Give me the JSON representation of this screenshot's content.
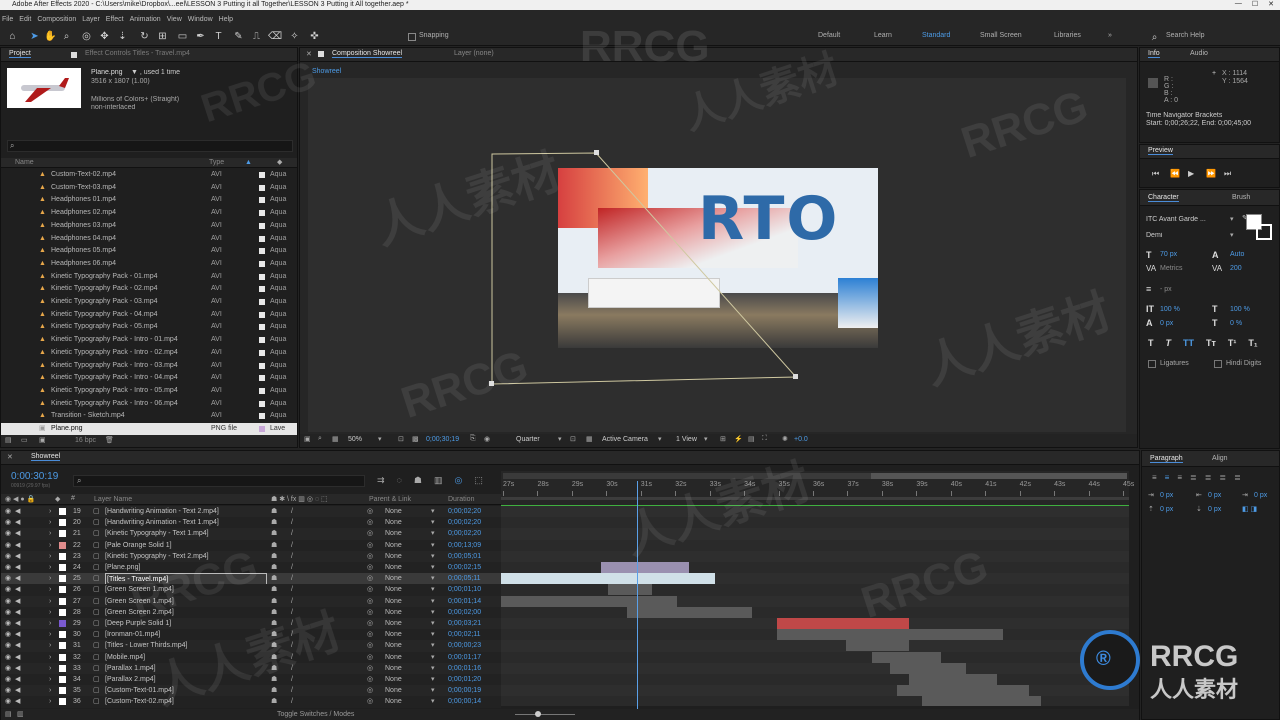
{
  "titlebar": {
    "title": "Adobe After Effects 2020 - C:\\Users\\mike\\Dropbox\\...eel\\LESSON 3 Putting it all Together\\LESSON 3 Putting it All together.aep *"
  },
  "menu": [
    "File",
    "Edit",
    "Composition",
    "Layer",
    "Effect",
    "Animation",
    "View",
    "Window",
    "Help"
  ],
  "toolbar": {
    "snapping": "Snapping",
    "workspaces": [
      "Default",
      "Learn",
      "Standard",
      "Small Screen",
      "Libraries"
    ],
    "active_workspace": "Standard",
    "search_help": "Search Help"
  },
  "project": {
    "tab_project": "Project",
    "tab_effects": "Effect Controls Titles - Travel.mp4",
    "item_name": "Plane.png",
    "item_used": ", used 1 time",
    "item_dims": "3516 x 1807 (1.00)",
    "item_colors": "Millions of Colors+ (Straight)",
    "item_interlace": "non-interlaced",
    "col_name": "Name",
    "col_type": "Type",
    "files": [
      {
        "name": "Custom-Text-02.mp4",
        "type": "AVI",
        "label": "Aqua"
      },
      {
        "name": "Custom-Text-03.mp4",
        "type": "AVI",
        "label": "Aqua"
      },
      {
        "name": "Headphones 01.mp4",
        "type": "AVI",
        "label": "Aqua"
      },
      {
        "name": "Headphones 02.mp4",
        "type": "AVI",
        "label": "Aqua"
      },
      {
        "name": "Headphones 03.mp4",
        "type": "AVI",
        "label": "Aqua"
      },
      {
        "name": "Headphones 04.mp4",
        "type": "AVI",
        "label": "Aqua"
      },
      {
        "name": "Headphones 05.mp4",
        "type": "AVI",
        "label": "Aqua"
      },
      {
        "name": "Headphones 06.mp4",
        "type": "AVI",
        "label": "Aqua"
      },
      {
        "name": "Kinetic Typography Pack - 01.mp4",
        "type": "AVI",
        "label": "Aqua"
      },
      {
        "name": "Kinetic Typography Pack - 02.mp4",
        "type": "AVI",
        "label": "Aqua"
      },
      {
        "name": "Kinetic Typography Pack - 03.mp4",
        "type": "AVI",
        "label": "Aqua"
      },
      {
        "name": "Kinetic Typography Pack - 04.mp4",
        "type": "AVI",
        "label": "Aqua"
      },
      {
        "name": "Kinetic Typography Pack - 05.mp4",
        "type": "AVI",
        "label": "Aqua"
      },
      {
        "name": "Kinetic Typography Pack - Intro - 01.mp4",
        "type": "AVI",
        "label": "Aqua"
      },
      {
        "name": "Kinetic Typography Pack - Intro - 02.mp4",
        "type": "AVI",
        "label": "Aqua"
      },
      {
        "name": "Kinetic Typography Pack - Intro - 03.mp4",
        "type": "AVI",
        "label": "Aqua"
      },
      {
        "name": "Kinetic Typography Pack - Intro - 04.mp4",
        "type": "AVI",
        "label": "Aqua"
      },
      {
        "name": "Kinetic Typography Pack - Intro - 05.mp4",
        "type": "AVI",
        "label": "Aqua"
      },
      {
        "name": "Kinetic Typography Pack - Intro - 06.mp4",
        "type": "AVI",
        "label": "Aqua"
      },
      {
        "name": "Transition - Sketch.mp4",
        "type": "AVI",
        "label": "Aqua"
      },
      {
        "name": "Plane.png",
        "type": "PNG file",
        "label": "Lave"
      }
    ],
    "bpc": "16 bpc"
  },
  "composition": {
    "tab": "Composition Showreel",
    "layer_tab": "Layer (none)",
    "breadcrumb": "Showreel",
    "zoom": "50%",
    "timecode": "0;00;30;19",
    "resolution": "Quarter",
    "camera": "Active Camera",
    "view": "1 View",
    "exposure": "+0.0",
    "preview_text": "RTO"
  },
  "info": {
    "tab_info": "Info",
    "tab_audio": "Audio",
    "rgb": [
      "R :",
      "G :",
      "B :",
      "A : 0"
    ],
    "x": "X : 1114",
    "y": "Y : 1564",
    "nav_title": "Time Navigator Brackets",
    "nav_range": "Start: 0;00;26;22, End: 0;00;45;00",
    "preview": "Preview"
  },
  "character": {
    "tab_character": "Character",
    "tab_brush": "Brush",
    "font": "ITC Avant Garde ...",
    "style": "Demi",
    "size": "70 px",
    "leading": "Auto",
    "kerning": "Metrics",
    "tracking": "200",
    "stroke": "- px",
    "vscale": "100 %",
    "hscale": "100 %",
    "baseline": "0 px",
    "tsume": "0 %",
    "ligatures": "Ligatures",
    "hindi": "Hindi Digits",
    "fill_color": "#ffffff",
    "stroke_color": "#ffffff"
  },
  "paragraph": {
    "tab_paragraph": "Paragraph",
    "tab_align": "Align",
    "indent_values": [
      "0 px",
      "0 px",
      "0 px",
      "0 px",
      "0 px"
    ]
  },
  "timeline": {
    "tab": "Showreel",
    "timecode": "0:00:30:19",
    "fps": "00919 (29.97 fps)",
    "col_layer": "Layer Name",
    "col_parent": "Parent & Link",
    "col_duration": "Duration",
    "ruler": [
      "27s",
      "28s",
      "29s",
      "30s",
      "31s",
      "32s",
      "33s",
      "34s",
      "35s",
      "36s",
      "37s",
      "38s",
      "39s",
      "40s",
      "41s",
      "42s",
      "43s",
      "44s",
      "45s"
    ],
    "toggle_label": "Toggle Switches / Modes",
    "layers": [
      {
        "num": "19",
        "name": "[Handwriting Animation - Text 2.mp4]",
        "parent": "None",
        "duration": "0;00;02;20",
        "color": "#ffffff",
        "bar_start": 0.0,
        "bar_end": 0.0
      },
      {
        "num": "20",
        "name": "[Handwriting Animation - Text 1.mp4]",
        "parent": "None",
        "duration": "0;00;02;20",
        "color": "#ffffff",
        "bar_start": 0.0,
        "bar_end": 0.0
      },
      {
        "num": "21",
        "name": "[Kinetic Typography - Text 1.mp4]",
        "parent": "None",
        "duration": "0;00;02;20",
        "color": "#ffffff",
        "bar_start": 0.0,
        "bar_end": 0.0
      },
      {
        "num": "22",
        "name": "[Pale Orange Solid 1]",
        "parent": "None",
        "duration": "0;00;13;09",
        "color": "#e08c8c",
        "bar_start": 0.0,
        "bar_end": 0.0
      },
      {
        "num": "23",
        "name": "[Kinetic Typography - Text 2.mp4]",
        "parent": "None",
        "duration": "0;00;05;01",
        "color": "#ffffff",
        "bar_start": 0.0,
        "bar_end": 0.0
      },
      {
        "num": "24",
        "name": "[Plane.png]",
        "parent": "None",
        "duration": "0;00;02;15",
        "color": "#ffffff",
        "bar_start": 0.16,
        "bar_end": 0.3
      },
      {
        "num": "25",
        "name": "[Titles - Travel.mp4]",
        "parent": "None",
        "duration": "0;00;05;11",
        "color": "#ffffff",
        "bar_start": 0.0,
        "bar_end": 0.34
      },
      {
        "num": "26",
        "name": "[Green Screen 1.mp4]",
        "parent": "None",
        "duration": "0;00;01;10",
        "color": "#ffffff",
        "bar_start": 0.17,
        "bar_end": 0.24
      },
      {
        "num": "27",
        "name": "[Green Screen 1.mp4]",
        "parent": "None",
        "duration": "0;00;01;14",
        "color": "#ffffff",
        "bar_start": 0.0,
        "bar_end": 0.28
      },
      {
        "num": "28",
        "name": "[Green Screen 2.mp4]",
        "parent": "None",
        "duration": "0;00;02;00",
        "color": "#ffffff",
        "bar_start": 0.2,
        "bar_end": 0.4
      },
      {
        "num": "29",
        "name": "[Deep Purple Solid 1]",
        "parent": "None",
        "duration": "0;00;03;21",
        "color": "#7a5ad0",
        "bar_start": 0.44,
        "bar_end": 0.65
      },
      {
        "num": "30",
        "name": "[Ironman-01.mp4]",
        "parent": "None",
        "duration": "0;00;02;11",
        "color": "#ffffff",
        "bar_start": 0.44,
        "bar_end": 0.8
      },
      {
        "num": "31",
        "name": "[Titles - Lower Thirds.mp4]",
        "parent": "None",
        "duration": "0;00;00;23",
        "color": "#ffffff",
        "bar_start": 0.55,
        "bar_end": 0.65
      },
      {
        "num": "32",
        "name": "[Mobile.mp4]",
        "parent": "None",
        "duration": "0;00;01;17",
        "color": "#ffffff",
        "bar_start": 0.59,
        "bar_end": 0.7
      },
      {
        "num": "33",
        "name": "[Parallax 1.mp4]",
        "parent": "None",
        "duration": "0;00;01;16",
        "color": "#ffffff",
        "bar_start": 0.62,
        "bar_end": 0.74
      },
      {
        "num": "34",
        "name": "[Parallax 2.mp4]",
        "parent": "None",
        "duration": "0;00;01;20",
        "color": "#ffffff",
        "bar_start": 0.65,
        "bar_end": 0.79
      },
      {
        "num": "35",
        "name": "[Custom-Text-01.mp4]",
        "parent": "None",
        "duration": "0;00;00;19",
        "color": "#ffffff",
        "bar_start": 0.63,
        "bar_end": 0.84
      },
      {
        "num": "36",
        "name": "[Custom-Text-02.mp4]",
        "parent": "None",
        "duration": "0;00;00;14",
        "color": "#ffffff",
        "bar_start": 0.67,
        "bar_end": 0.86
      }
    ]
  },
  "watermark": {
    "rrcg": "RRCG",
    "cn": "人人素材"
  }
}
